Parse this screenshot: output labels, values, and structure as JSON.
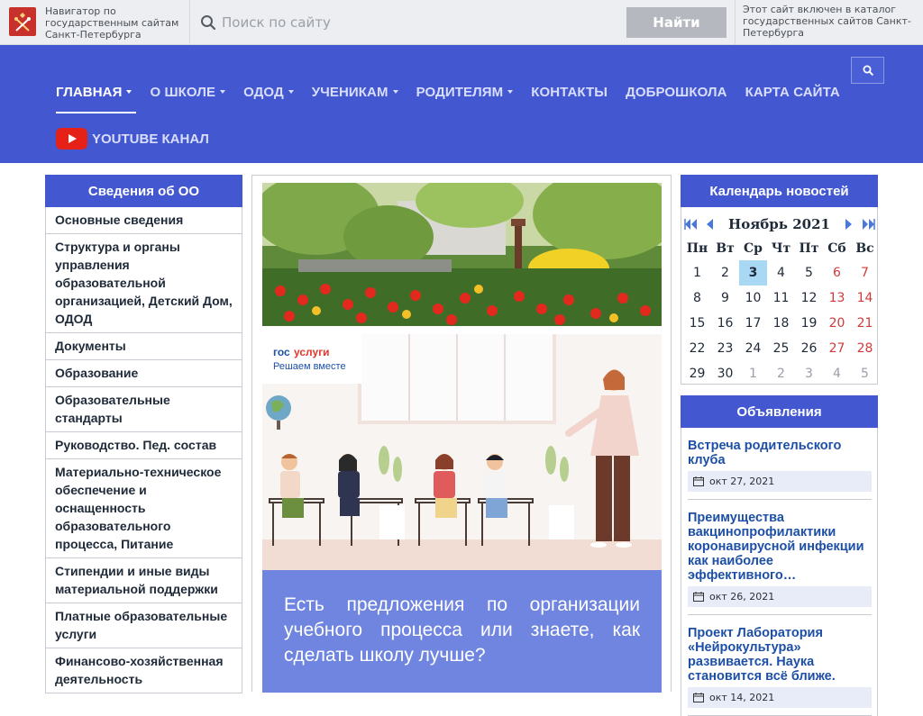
{
  "gov_bar": {
    "navigator_text": "Навигатор по государственным сайтам Санкт-Петербурга",
    "search_placeholder": "Поиск по сайту",
    "search_button": "Найти",
    "included_text": "Этот сайт включен в каталог государственных сайтов Санкт-Петербурга"
  },
  "header": {
    "nav": [
      {
        "label": "ГЛАВНАЯ",
        "has_caret": true,
        "active": true
      },
      {
        "label": "О ШКОЛЕ",
        "has_caret": true
      },
      {
        "label": "ОДОД",
        "has_caret": true
      },
      {
        "label": "УЧЕНИКАМ",
        "has_caret": true
      },
      {
        "label": "РОДИТЕЛЯМ",
        "has_caret": true
      },
      {
        "label": "КОНТАКТЫ",
        "has_caret": false
      },
      {
        "label": "ДОБРОШКОЛА",
        "has_caret": false
      },
      {
        "label": "КАРТА САЙТА",
        "has_caret": false
      }
    ],
    "youtube_label": "YOUTUBE КАНАЛ"
  },
  "sidebar": {
    "title": "Сведения об ОО",
    "items": [
      "Основные сведения",
      "Структура и органы управления образовательной организацией, Детский Дом, ОДОД",
      "Документы",
      "Образование",
      "Образовательные стандарты",
      "Руководство. Пед. состав",
      "Материально-техническое обеспечение и оснащенность образовательного процесса, Питание",
      "Стипендии и иные виды материальной поддержки",
      "Платные образовательные услуги",
      "Финансово-хозяйственная деятельность"
    ]
  },
  "banner": {
    "gosuslugi_prefix": "гос",
    "gosuslugi_suffix": "услуги",
    "slogan": "Решаем вместе",
    "question": "Есть предложения по организации учебного процесса или знаете, как сделать школу лучше?"
  },
  "calendar": {
    "title": "Календарь новостей",
    "month": "Ноябрь 2021",
    "weekdays": [
      "Пн",
      "Вт",
      "Ср",
      "Чт",
      "Пт",
      "Сб",
      "Вс"
    ],
    "weeks": [
      [
        "1",
        "2",
        "3",
        "4",
        "5",
        "6",
        "7"
      ],
      [
        "8",
        "9",
        "10",
        "11",
        "12",
        "13",
        "14"
      ],
      [
        "15",
        "16",
        "17",
        "18",
        "19",
        "20",
        "21"
      ],
      [
        "22",
        "23",
        "24",
        "25",
        "26",
        "27",
        "28"
      ],
      [
        "29",
        "30",
        "1",
        "2",
        "3",
        "4",
        "5"
      ]
    ],
    "today": "3"
  },
  "announcements": {
    "title": "Объявления",
    "items": [
      {
        "title": "Встреча родительского клуба",
        "date": "окт 27, 2021"
      },
      {
        "title": "Преимущества вакцинопрофилактики коронавирусной инфекции как наиболее эффективного…",
        "date": "окт 26, 2021"
      },
      {
        "title": "Проект Лаборатория «Нейрокультура» развивается. Наука становится всё ближе.",
        "date": "окт 14, 2021"
      }
    ]
  },
  "colors": {
    "brand_blue": "#4358d0",
    "gov_red": "#c8302c",
    "link_blue": "#1d4fa6",
    "weekend_red": "#d23a3a",
    "today_bg": "#a9d8f5"
  }
}
